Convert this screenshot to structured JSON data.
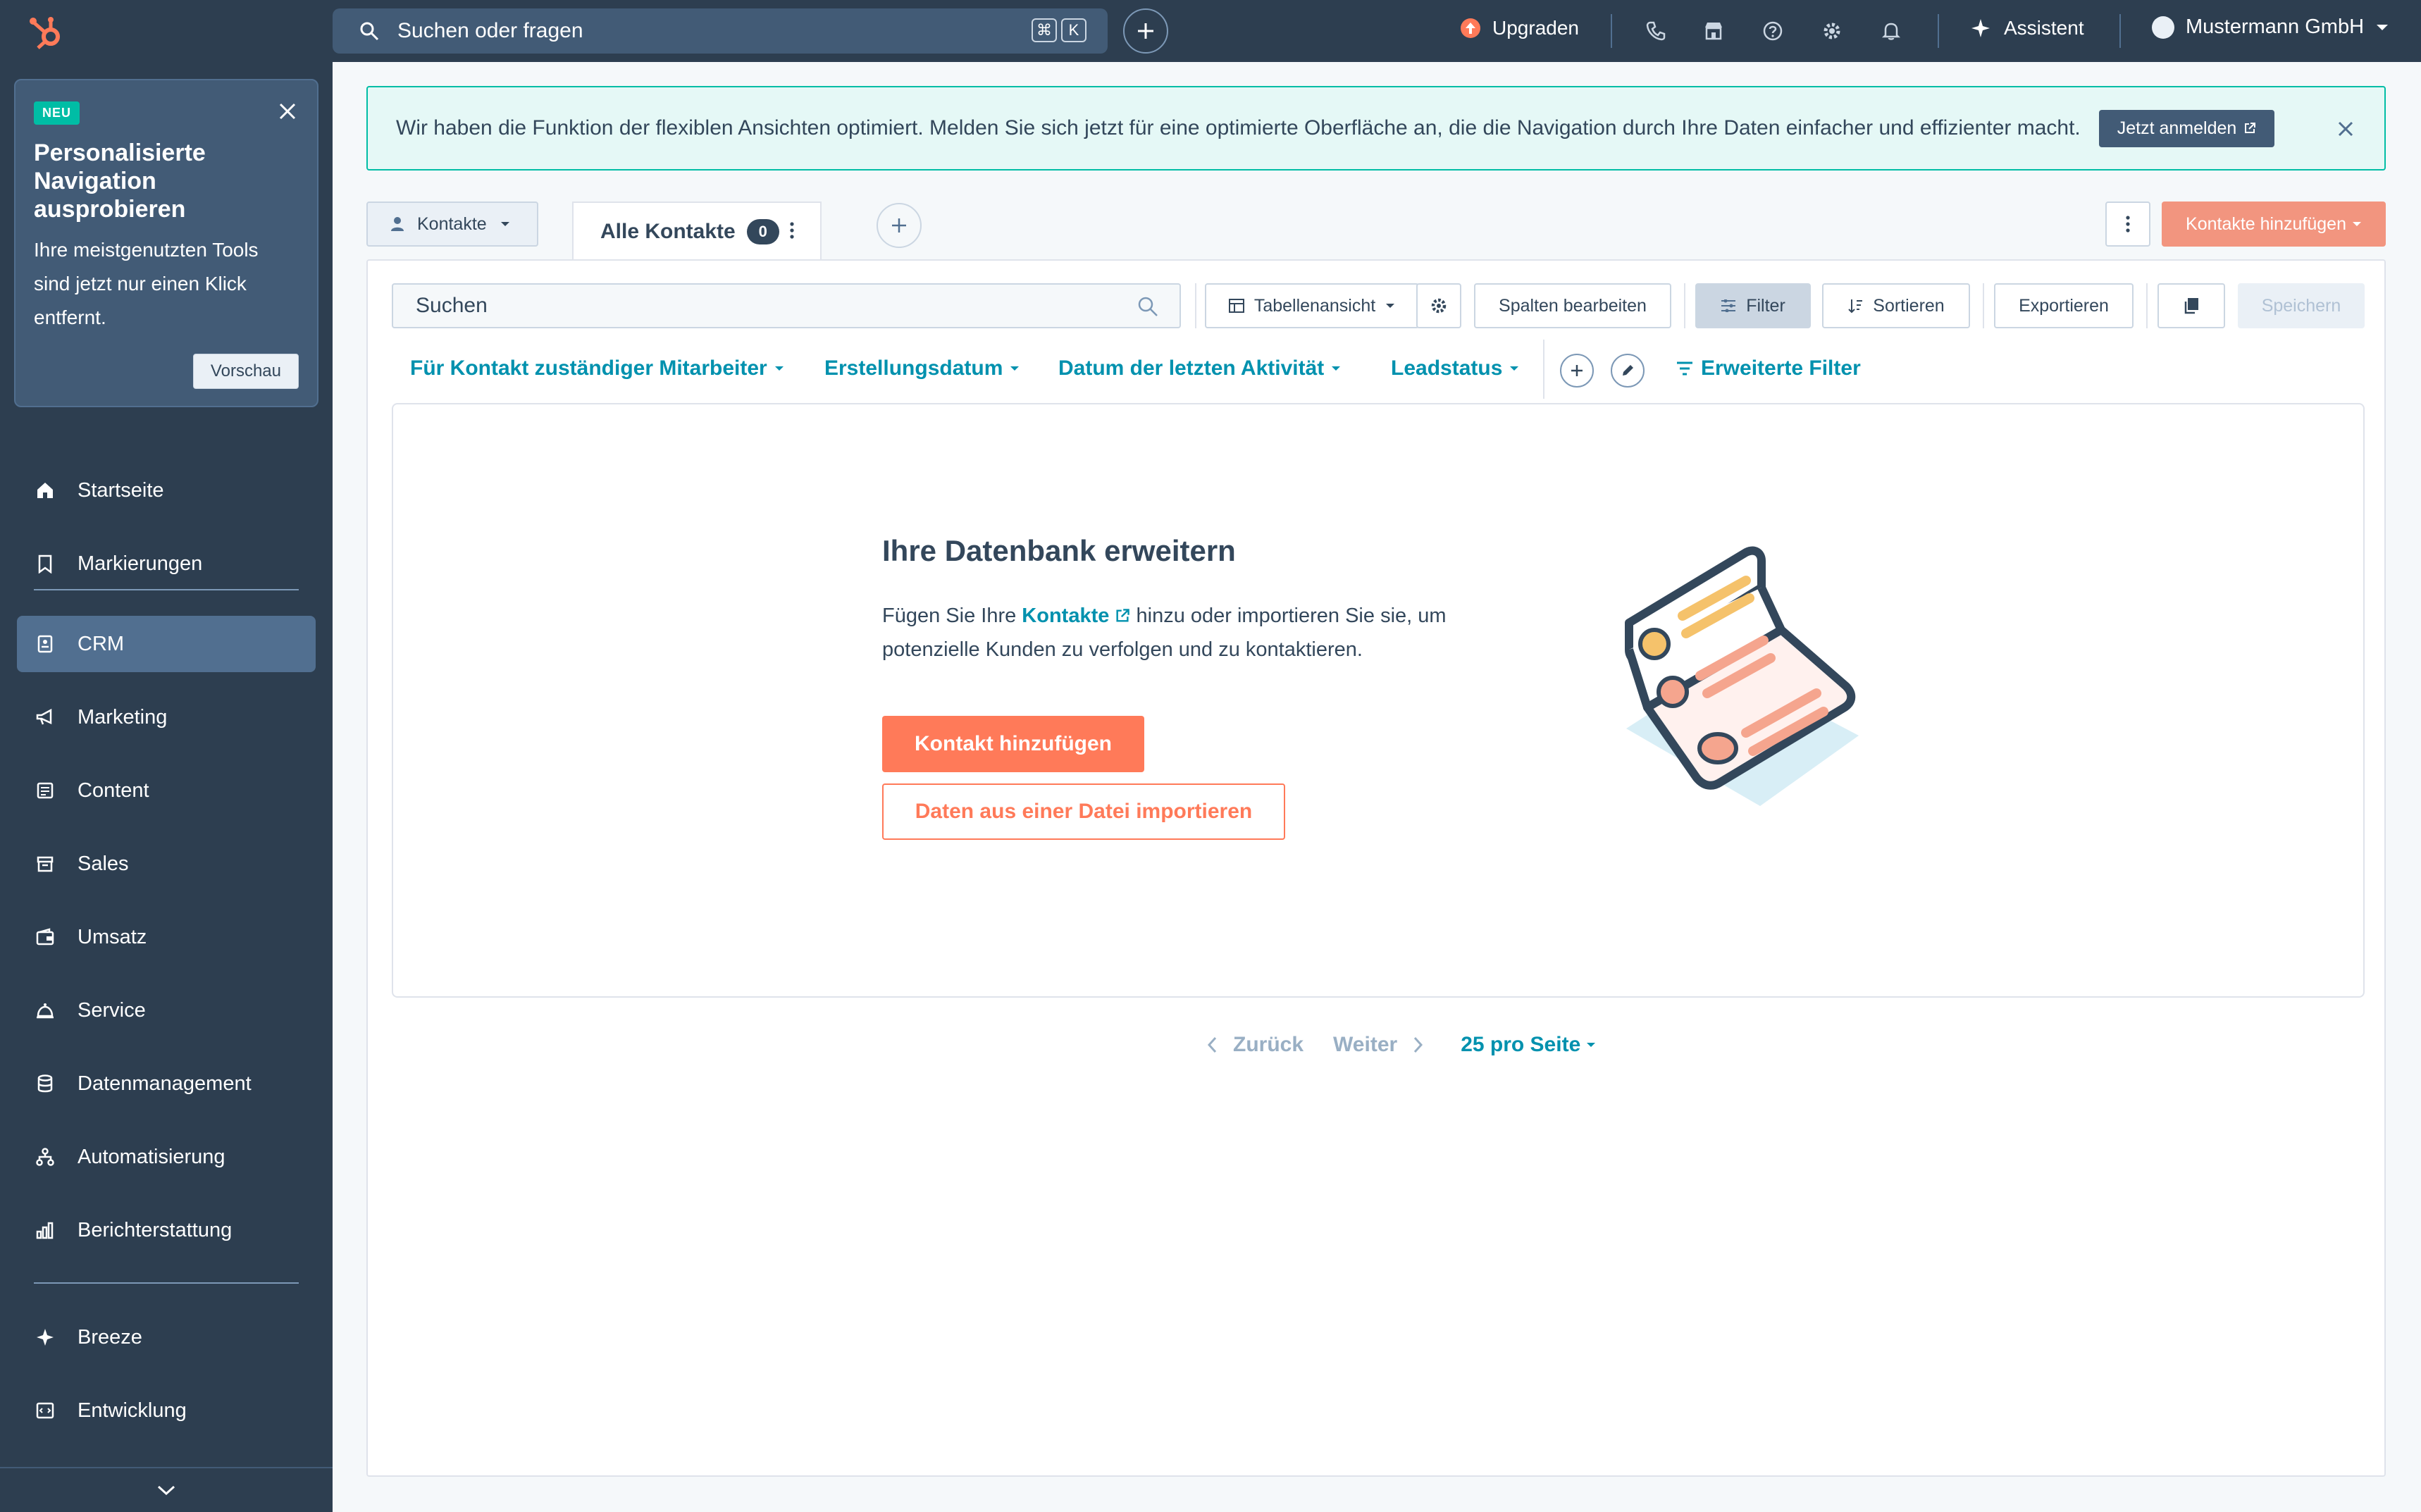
{
  "topbar": {
    "search_placeholder": "Suchen oder fragen",
    "kbd_cmd": "⌘",
    "kbd_k": "K",
    "upgrade_label": "Upgraden",
    "assistant_label": "Assistent",
    "account_label": "Mustermann GmbH"
  },
  "promo": {
    "badge": "NEU",
    "title": "Personalisierte Navigation ausprobieren",
    "text": "Ihre meistgenutzten Tools sind jetzt nur einen Klick entfernt.",
    "button": "Vorschau"
  },
  "sidebar": {
    "items": [
      {
        "label": "Startseite",
        "icon": "home-icon"
      },
      {
        "label": "Markierungen",
        "icon": "bookmark-icon"
      },
      {
        "label": "CRM",
        "icon": "crm-icon",
        "active": true
      },
      {
        "label": "Marketing",
        "icon": "megaphone-icon"
      },
      {
        "label": "Content",
        "icon": "content-icon"
      },
      {
        "label": "Sales",
        "icon": "sales-icon"
      },
      {
        "label": "Umsatz",
        "icon": "wallet-icon"
      },
      {
        "label": "Service",
        "icon": "service-icon"
      },
      {
        "label": "Datenmanagement",
        "icon": "database-icon"
      },
      {
        "label": "Automatisierung",
        "icon": "automation-icon"
      },
      {
        "label": "Berichterstattung",
        "icon": "report-icon"
      },
      {
        "label": "Breeze",
        "icon": "sparkle-icon"
      },
      {
        "label": "Entwicklung",
        "icon": "code-icon"
      }
    ]
  },
  "banner": {
    "text": "Wir haben die Funktion der flexiblen Ansichten optimiert. Melden Sie sich jetzt für eine optimierte Oberfläche an, die die Navigation durch Ihre Daten einfacher und effizienter macht.",
    "cta": "Jetzt anmelden"
  },
  "header": {
    "object_select": "Kontakte",
    "view_tab": "Alle Kontakte",
    "view_count": "0",
    "add_contacts": "Kontakte hinzufügen"
  },
  "toolbar": {
    "search_placeholder": "Suchen",
    "table_view": "Tabellenansicht",
    "edit_columns": "Spalten bearbeiten",
    "filter": "Filter",
    "sort": "Sortieren",
    "export": "Exportieren",
    "save": "Speichern"
  },
  "quick_filters": {
    "owner": "Für Kontakt zuständiger Mitarbeiter",
    "created": "Erstellungsdatum",
    "last_activity": "Datum der letzten Aktivität",
    "lead_status": "Leadstatus",
    "advanced": "Erweiterte Filter"
  },
  "empty_state": {
    "title": "Ihre Datenbank erweitern",
    "desc_pre": "Fügen Sie Ihre ",
    "desc_link": "Kontakte",
    "desc_post": " hinzu oder importieren Sie sie, um potenzielle Kunden zu verfolgen und zu kontaktieren.",
    "primary_button": "Kontakt hinzufügen",
    "secondary_button": "Daten aus einer Datei importieren"
  },
  "pagination": {
    "back": "Zurück",
    "next": "Weiter",
    "per_page": "25 pro Seite"
  },
  "colors": {
    "topbar": "#2d3e50",
    "accent_orange": "#ff7a59",
    "link_blue": "#0091ae",
    "teal": "#00bda5"
  }
}
